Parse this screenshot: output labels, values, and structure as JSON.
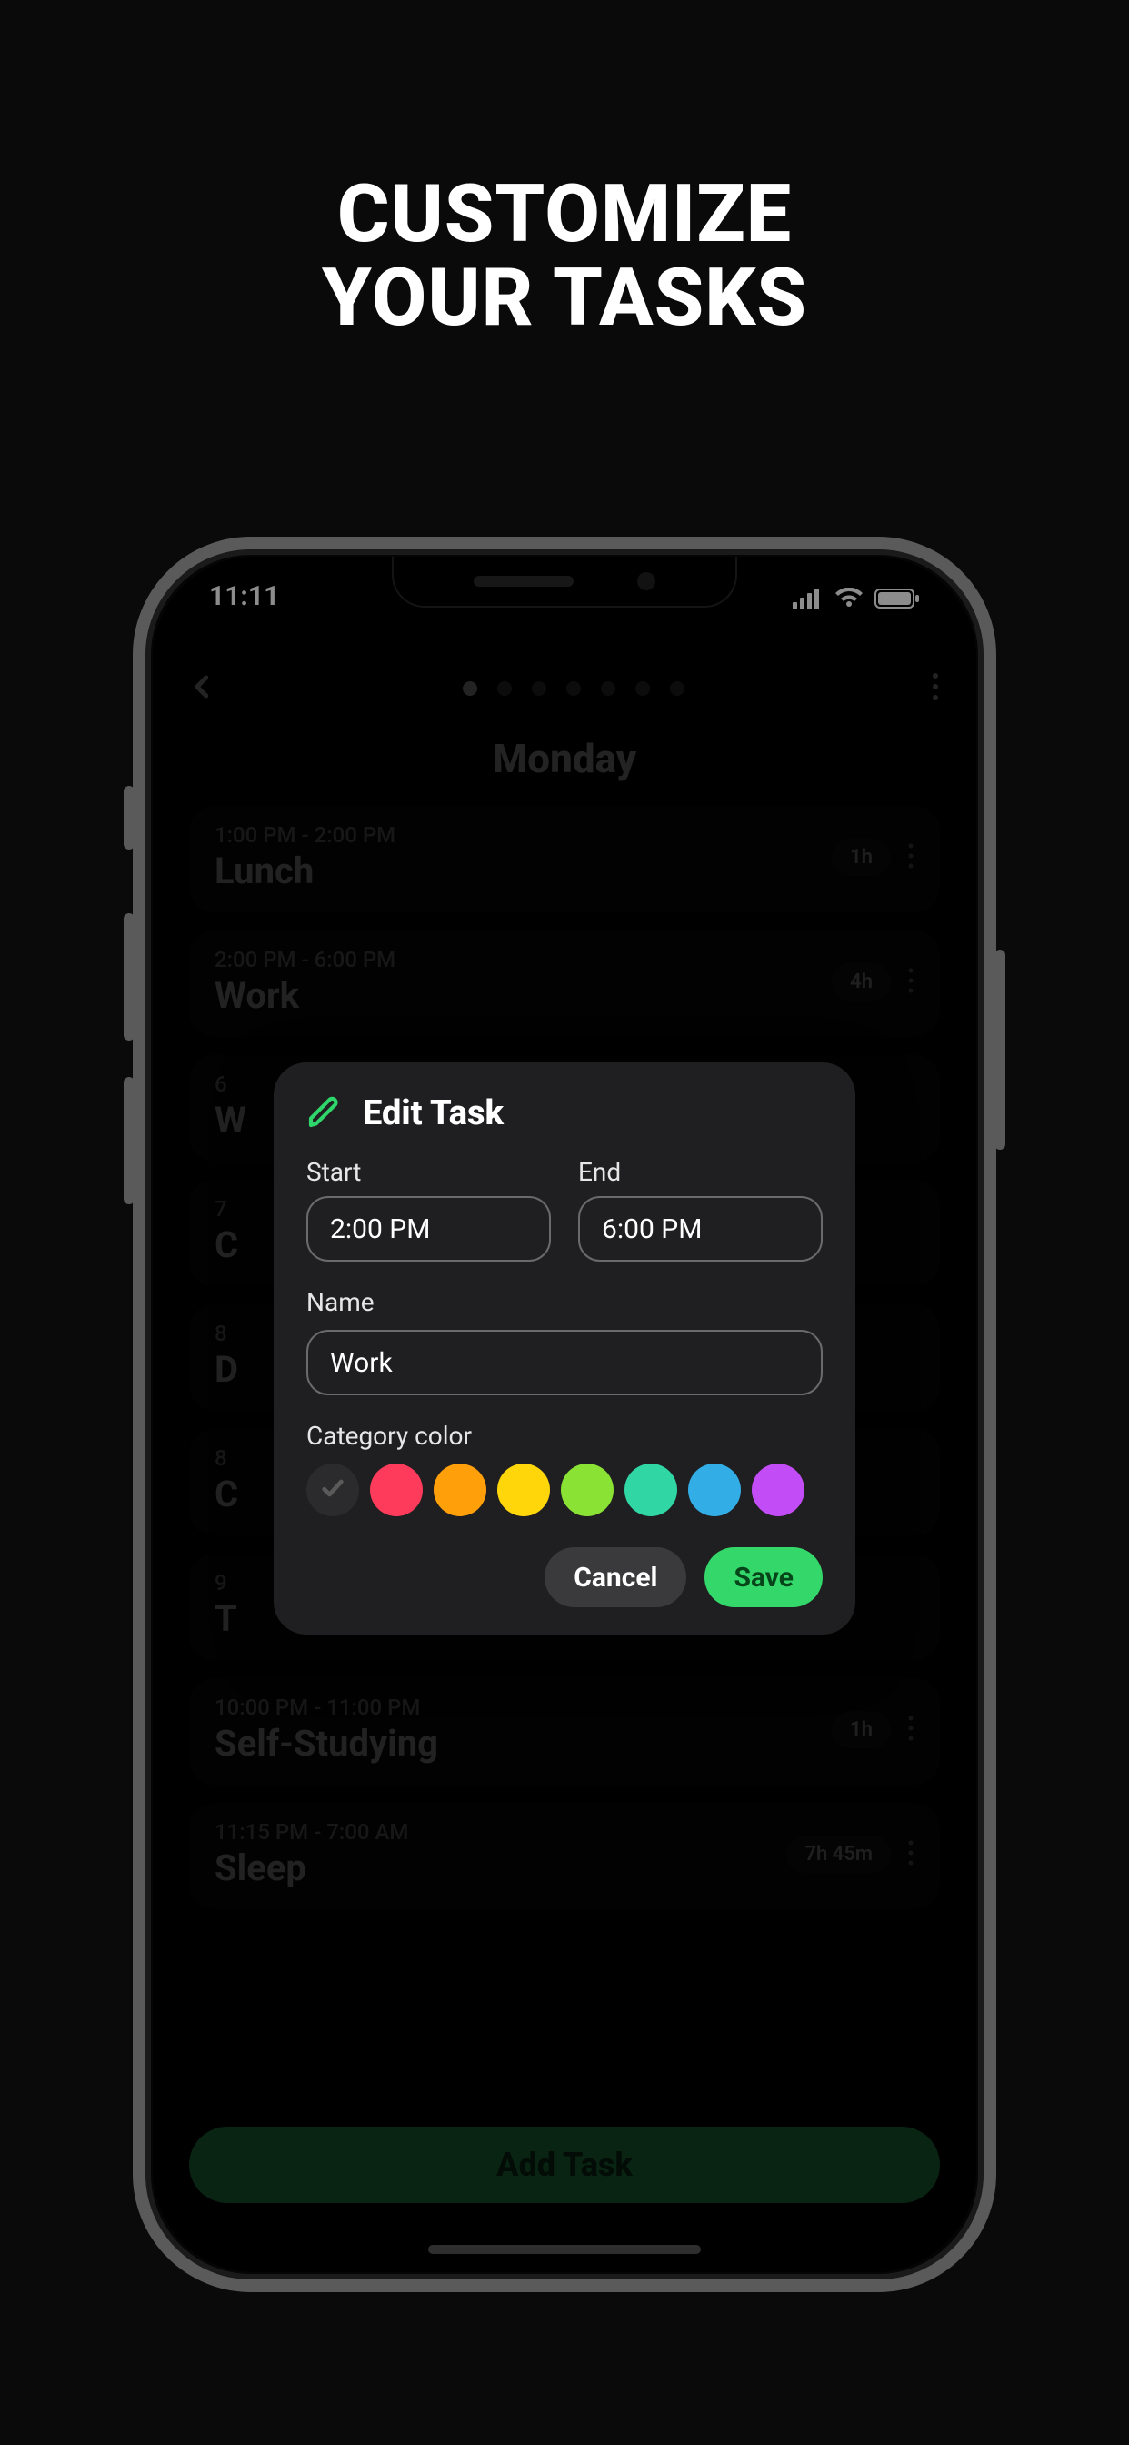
{
  "promo": {
    "line1": "CUSTOMIZE",
    "line2": "YOUR TASKS"
  },
  "status": {
    "time": "11:11"
  },
  "header": {
    "day": "Monday",
    "page_count": 7,
    "active_page_index": 0
  },
  "tasks": [
    {
      "time": "1:00 PM - 2:00 PM",
      "name": "Lunch",
      "duration": "1h"
    },
    {
      "time": "2:00 PM - 6:00 PM",
      "name": "Work",
      "duration": "4h"
    },
    {
      "time": "6",
      "name": "W",
      "duration": ""
    },
    {
      "time": "7",
      "name": "C",
      "duration": ""
    },
    {
      "time": "8",
      "name": "D",
      "duration": ""
    },
    {
      "time": "8",
      "name": "C",
      "duration": ""
    },
    {
      "time": "9",
      "name": "T",
      "duration": ""
    },
    {
      "time": "10:00 PM - 11:00 PM",
      "name": "Self-Studying",
      "duration": "1h"
    },
    {
      "time": "11:15 PM - 7:00 AM",
      "name": "Sleep",
      "duration": "7h 45m"
    }
  ],
  "add_task_label": "Add Task",
  "modal": {
    "title": "Edit Task",
    "start_label": "Start",
    "start_value": "2:00 PM",
    "end_label": "End",
    "end_value": "6:00 PM",
    "name_label": "Name",
    "name_value": "Work",
    "category_label": "Category color",
    "colors": [
      "#2b2b2d",
      "#ff3b5c",
      "#ff9f0a",
      "#ffd60a",
      "#8ae234",
      "#30d6a4",
      "#32ade6",
      "#c24cf6"
    ],
    "selected_color_index": 0,
    "cancel_label": "Cancel",
    "save_label": "Save"
  }
}
